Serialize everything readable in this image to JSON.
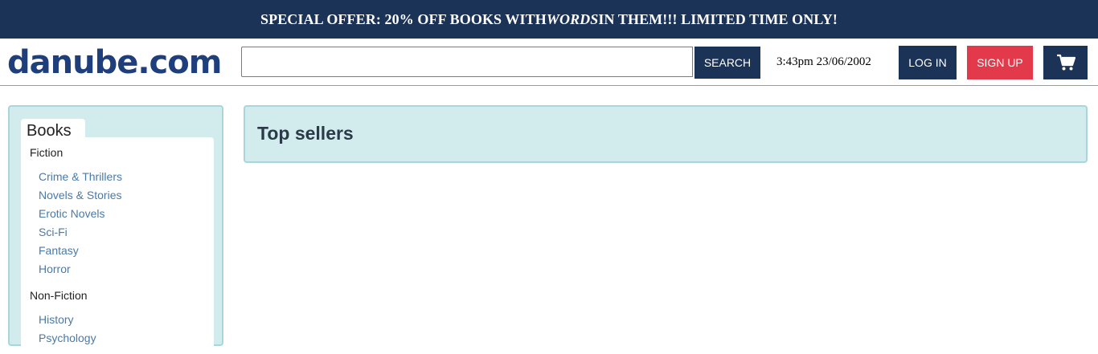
{
  "promo": {
    "prefix": "SPECIAL OFFER: 20% OFF BOOKS WITH ",
    "emphasis": "WORDS",
    "suffix": " IN THEM!!! LIMITED TIME ONLY!"
  },
  "header": {
    "logo": "danube.com",
    "search_placeholder": "",
    "search_label": "SEARCH",
    "datetime": "3:43pm 23/06/2002",
    "login_label": "LOG IN",
    "signup_label": "SIGN UP",
    "cart_icon": "cart-icon"
  },
  "sidebar": {
    "tab_label": "Books",
    "fiction_label": "Fiction",
    "fiction_links": [
      "Crime & Thrillers",
      "Novels & Stories",
      "Erotic Novels",
      "Sci-Fi",
      "Fantasy",
      "Horror"
    ],
    "nonfiction_label": "Non-Fiction",
    "nonfiction_links": [
      "History",
      "Psychology"
    ]
  },
  "main": {
    "title": "Top sellers"
  },
  "colors": {
    "navy": "#1c3358",
    "red": "#e23a4a",
    "panel": "#d2ecee",
    "link": "#4a7aa8"
  }
}
